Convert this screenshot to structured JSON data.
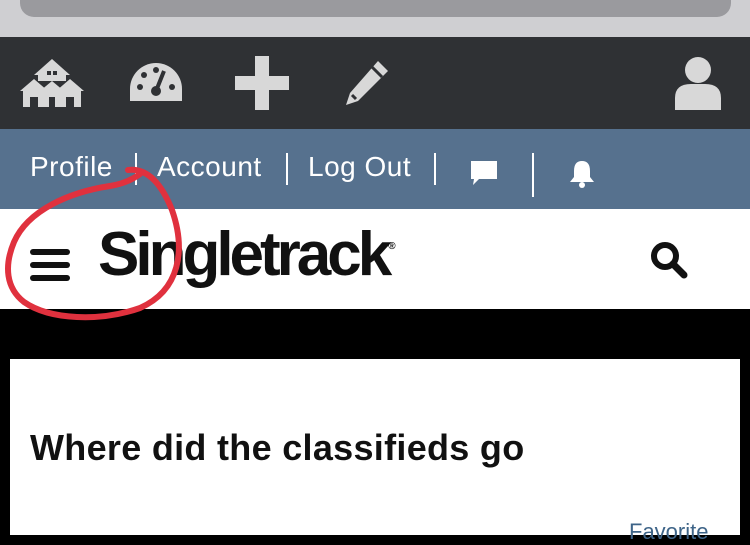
{
  "browser": {
    "address_bar": ""
  },
  "toolbar": {
    "icons": [
      "home-icon",
      "dashboard-icon",
      "plus-icon",
      "pencil-icon",
      "user-icon"
    ]
  },
  "nav": {
    "profile": "Profile",
    "account": "Account",
    "logout": "Log Out",
    "icons": [
      "chat-icon",
      "bell-icon"
    ]
  },
  "header": {
    "logo_text": "Singletrack",
    "logo_mark": "®"
  },
  "post": {
    "title": "Where did the classifieds go",
    "favorite": "Favorite"
  },
  "colors": {
    "toolbar_bg": "#2f3134",
    "nav_bg": "#56718e",
    "annotation": "#e0313e",
    "link": "#3e6488"
  }
}
